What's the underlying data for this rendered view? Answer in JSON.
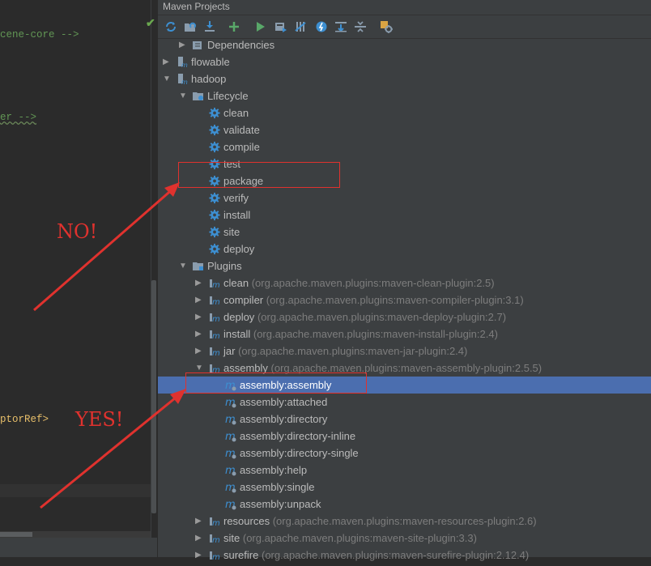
{
  "editor": {
    "line1": "cene-core -->",
    "line2": "er -->",
    "line3": "ptorRef>"
  },
  "panel": {
    "title": "Maven Projects"
  },
  "toolbar": [
    {
      "name": "reimport-icon"
    },
    {
      "name": "generate-sources-icon"
    },
    {
      "name": "download-icon"
    },
    {
      "name": "add-project-icon"
    },
    {
      "name": "run-icon"
    },
    {
      "name": "execute-goal-icon"
    },
    {
      "name": "toggle-offline-icon"
    },
    {
      "name": "skip-tests-icon"
    },
    {
      "name": "show-dependencies-icon"
    },
    {
      "name": "collapse-all-icon"
    },
    {
      "name": "settings-icon"
    }
  ],
  "tree": {
    "dependencies": "Dependencies",
    "flowable": "flowable",
    "hadoop": "hadoop",
    "lifecycle": "Lifecycle",
    "lifecycle_items": [
      "clean",
      "validate",
      "compile",
      "test",
      "package",
      "verify",
      "install",
      "site",
      "deploy"
    ],
    "plugins": "Plugins",
    "plugin_items": [
      {
        "label": "clean",
        "sub": "(org.apache.maven.plugins:maven-clean-plugin:2.5)"
      },
      {
        "label": "compiler",
        "sub": "(org.apache.maven.plugins:maven-compiler-plugin:3.1)"
      },
      {
        "label": "deploy",
        "sub": "(org.apache.maven.plugins:maven-deploy-plugin:2.7)"
      },
      {
        "label": "install",
        "sub": "(org.apache.maven.plugins:maven-install-plugin:2.4)"
      },
      {
        "label": "jar",
        "sub": "(org.apache.maven.plugins:maven-jar-plugin:2.4)"
      }
    ],
    "assembly": {
      "label": "assembly",
      "sub": "(org.apache.maven.plugins:maven-assembly-plugin:2.5.5)"
    },
    "assembly_goals": [
      "assembly:assembly",
      "assembly:attached",
      "assembly:directory",
      "assembly:directory-inline",
      "assembly:directory-single",
      "assembly:help",
      "assembly:single",
      "assembly:unpack"
    ],
    "more_plugins": [
      {
        "label": "resources",
        "sub": "(org.apache.maven.plugins:maven-resources-plugin:2.6)"
      },
      {
        "label": "site",
        "sub": "(org.apache.maven.plugins:maven-site-plugin:3.3)"
      },
      {
        "label": "surefire",
        "sub": "(org.apache.maven.plugins:maven-surefire-plugin:2.12.4)"
      }
    ]
  },
  "annotations": {
    "no": "NO!",
    "yes": "YES!"
  },
  "colors": {
    "selection": "#4b6eaf",
    "annotation": "#e0322e",
    "run": "#59a869",
    "gear": "#3d8fd1"
  }
}
